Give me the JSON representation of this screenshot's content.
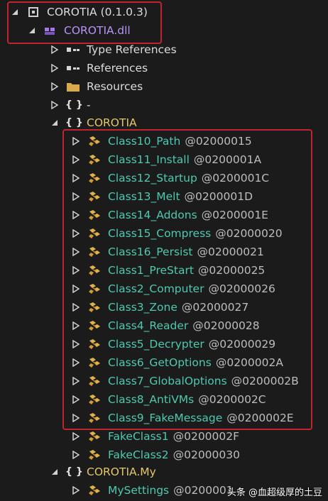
{
  "tree": {
    "assembly": "COROTIA (0.1.0.3)",
    "module": "COROTIA.dll",
    "type_references": "Type References",
    "references": "References",
    "resources": "Resources",
    "empty_namespace": "-",
    "namespace_main": "COROTIA",
    "classes": [
      {
        "name": "Class10_Path",
        "token": "@02000015"
      },
      {
        "name": "Class11_Install",
        "token": "@0200001A"
      },
      {
        "name": "Class12_Startup",
        "token": "@0200001C"
      },
      {
        "name": "Class13_Melt",
        "token": "@0200001D"
      },
      {
        "name": "Class14_Addons",
        "token": "@0200001E"
      },
      {
        "name": "Class15_Compress",
        "token": "@02000020"
      },
      {
        "name": "Class16_Persist",
        "token": "@02000021"
      },
      {
        "name": "Class1_PreStart",
        "token": "@02000025"
      },
      {
        "name": "Class2_Computer",
        "token": "@02000026"
      },
      {
        "name": "Class3_Zone",
        "token": "@02000027"
      },
      {
        "name": "Class4_Reader",
        "token": "@02000028"
      },
      {
        "name": "Class5_Decrypter",
        "token": "@02000029"
      },
      {
        "name": "Class6_GetOptions",
        "token": "@0200002A"
      },
      {
        "name": "Class7_GlobalOptions",
        "token": "@0200002B"
      },
      {
        "name": "Class8_AntiVMs",
        "token": "@0200002C"
      },
      {
        "name": "Class9_FakeMessage",
        "token": "@0200002E"
      },
      {
        "name": "FakeClass1",
        "token": "@0200002F"
      },
      {
        "name": "FakeClass2",
        "token": "@02000030"
      }
    ],
    "namespace_my": "COROTIA.My",
    "my_classes": [
      {
        "name": "MySettings",
        "token": "@0200001"
      }
    ]
  },
  "watermark": "头条 @血超级厚的土豆",
  "colors": {
    "highlight_box": "#c0242c",
    "class_text": "#4ec9b0",
    "namespace_text": "#e3c76a",
    "module_text": "#b794f6"
  }
}
